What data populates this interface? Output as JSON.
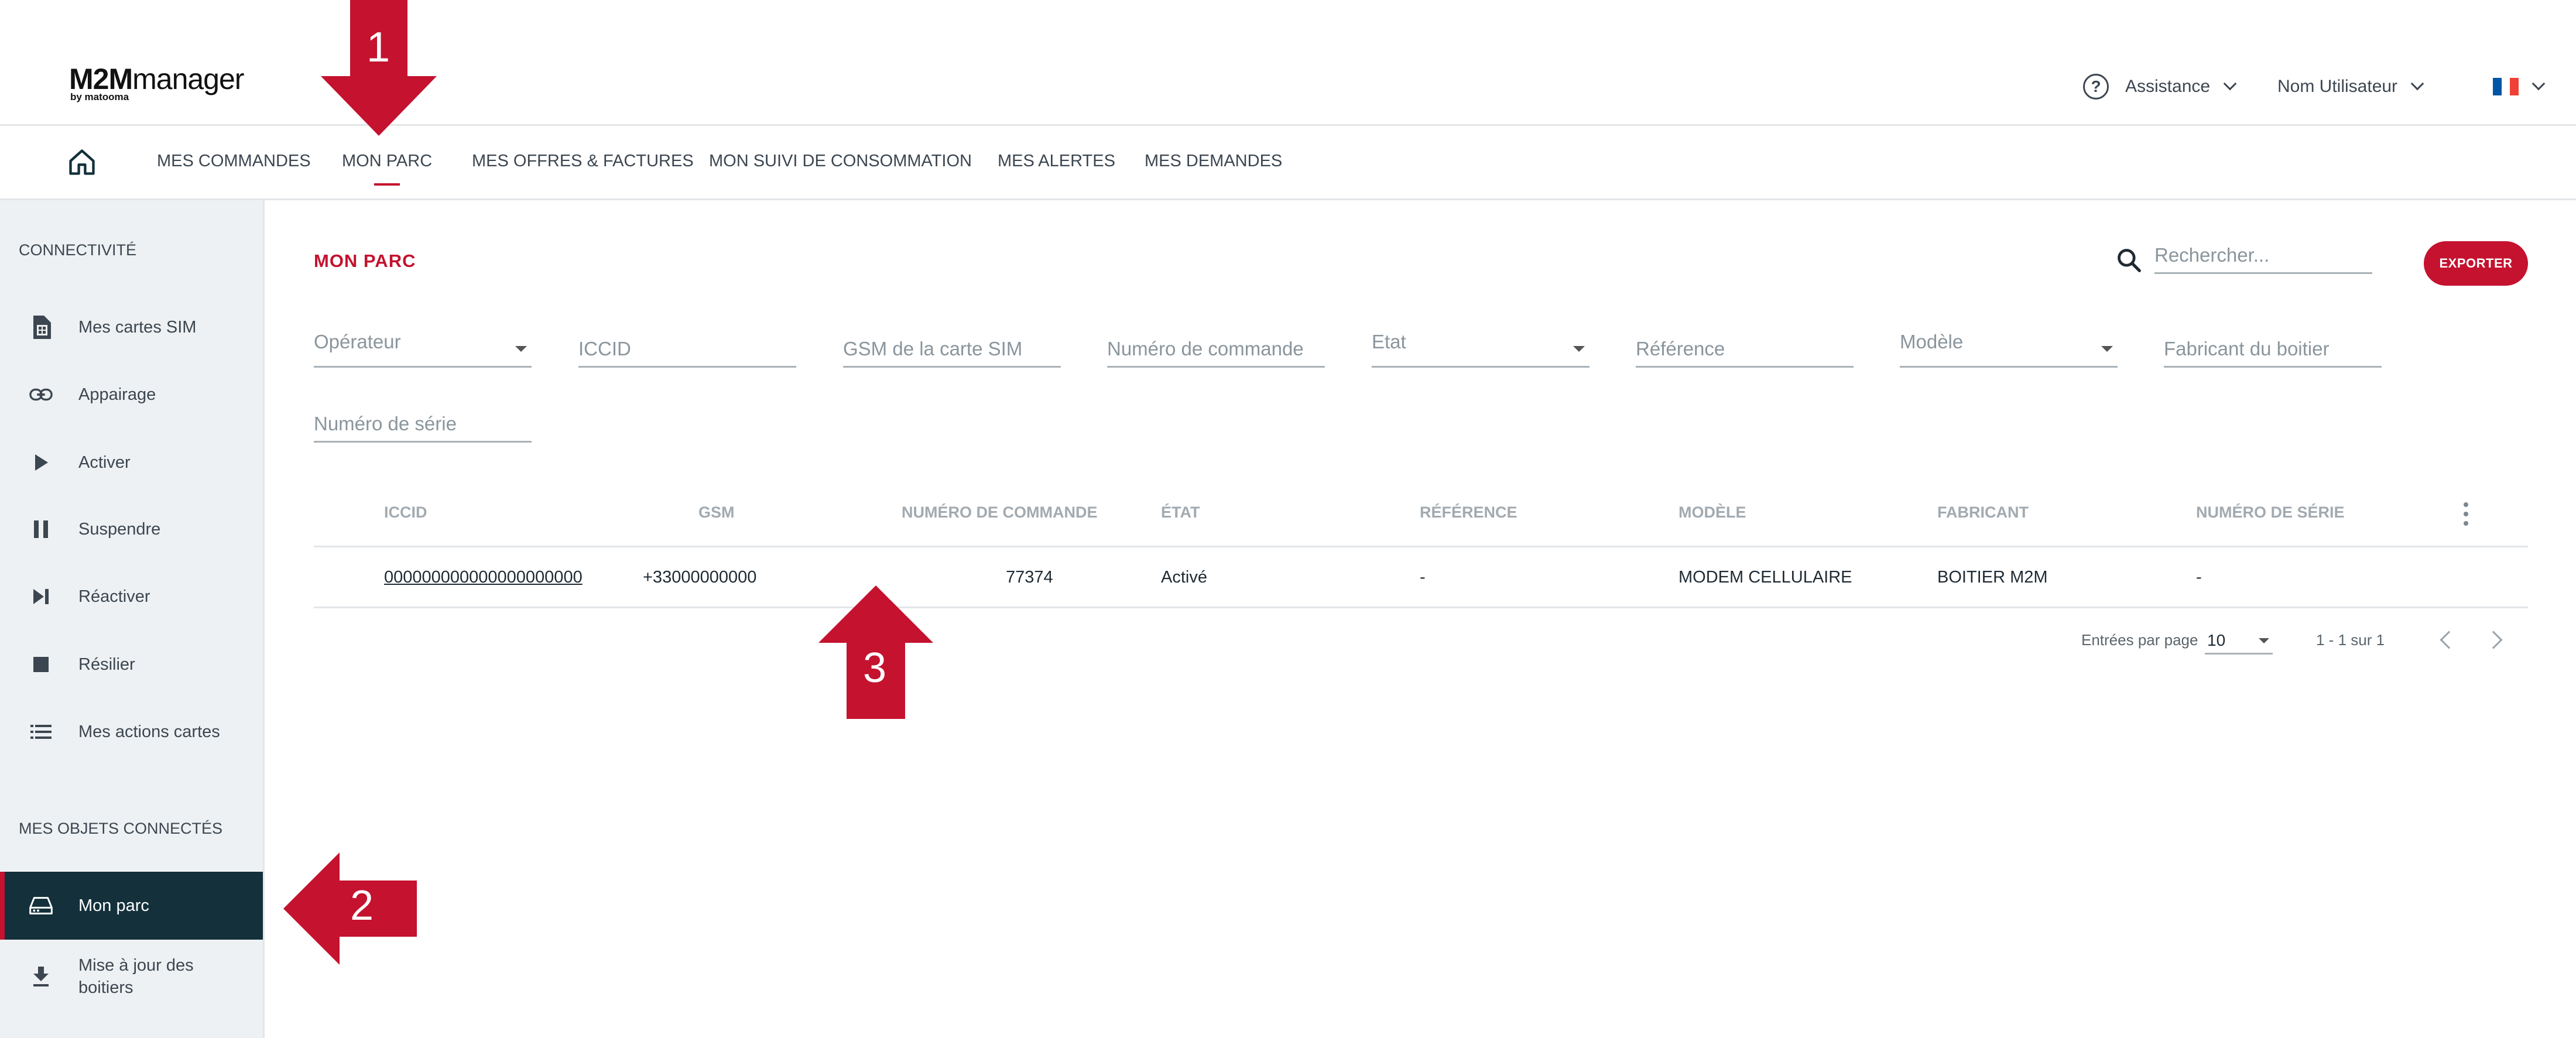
{
  "header": {
    "logo_main_bold": "M2M",
    "logo_main_rest": "manager",
    "logo_sub": "by matooma",
    "assistance_label": "Assistance",
    "user_label": "Nom Utilisateur",
    "lang_flag": "FR",
    "flag_colors": [
      "#0055a4",
      "#ffffff",
      "#ef4135"
    ]
  },
  "nav": {
    "items": [
      {
        "label": "MES COMMANDES"
      },
      {
        "label": "MON PARC",
        "active": true
      },
      {
        "label": "MES OFFRES & FACTURES"
      },
      {
        "label": "MON SUIVI DE CONSOMMATION"
      },
      {
        "label": "MES ALERTES"
      },
      {
        "label": "MES DEMANDES"
      }
    ]
  },
  "sidebar": {
    "section1_title": "CONNECTIVITÉ",
    "section1_items": [
      {
        "label": "Mes cartes SIM",
        "icon": "sim-card-icon"
      },
      {
        "label": "Appairage",
        "icon": "link-icon"
      },
      {
        "label": "Activer",
        "icon": "play-icon"
      },
      {
        "label": "Suspendre",
        "icon": "pause-icon"
      },
      {
        "label": "Réactiver",
        "icon": "skip-next-icon"
      },
      {
        "label": "Résilier",
        "icon": "stop-icon"
      },
      {
        "label": "Mes actions cartes",
        "icon": "list-icon"
      }
    ],
    "section2_title": "MES OBJETS CONNECTÉS",
    "section2_items": [
      {
        "label": "Mon parc",
        "icon": "device-icon",
        "active": true
      },
      {
        "label": "Mise à jour des boitiers",
        "icon": "download-icon"
      }
    ]
  },
  "main": {
    "title": "MON PARC",
    "search_placeholder": "Rechercher...",
    "export_label": "EXPORTER",
    "filters": [
      {
        "label": "Opérateur",
        "type": "select"
      },
      {
        "label": "ICCID",
        "type": "text"
      },
      {
        "label": "GSM de la carte SIM",
        "type": "text"
      },
      {
        "label": "Numéro de commande",
        "type": "text"
      },
      {
        "label": "Etat",
        "type": "select"
      },
      {
        "label": "Référence",
        "type": "text"
      },
      {
        "label": "Modèle",
        "type": "select"
      },
      {
        "label": "Fabricant du boitier",
        "type": "text"
      },
      {
        "label": "Numéro de série",
        "type": "text"
      }
    ],
    "table": {
      "columns": [
        "ICCID",
        "GSM",
        "NUMÉRO DE COMMANDE",
        "ÉTAT",
        "RÉFÉRENCE",
        "MODÈLE",
        "FABRICANT",
        "NUMÉRO DE SÉRIE"
      ],
      "rows": [
        [
          "000000000000000000000",
          "+33000000000",
          "77374",
          "Activé",
          "-",
          "MODEM CELLULAIRE",
          "BOITIER M2M",
          "-"
        ]
      ]
    },
    "pagination": {
      "per_page_label": "Entrées par page",
      "per_page_value": "10",
      "range": "1 - 1 sur 1"
    }
  },
  "annotations": {
    "color": "#c4122f",
    "labels": [
      "1",
      "2",
      "3"
    ]
  }
}
